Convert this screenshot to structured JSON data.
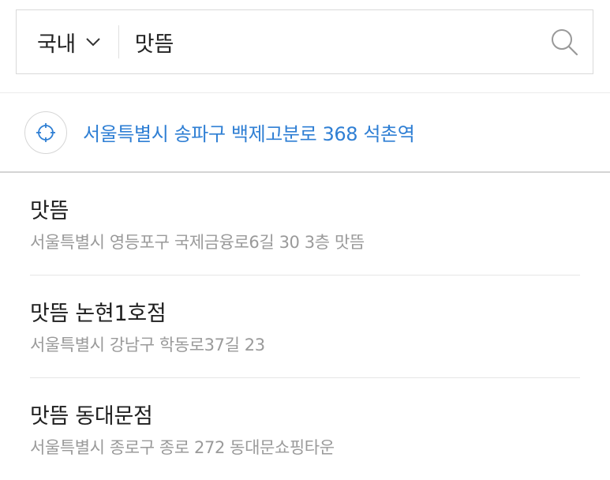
{
  "search": {
    "region": "국내",
    "query": "맛뜸"
  },
  "current_location": {
    "address": "서울특별시 송파구 백제고분로 368 석촌역"
  },
  "results": [
    {
      "title": "맛뜸",
      "address": "서울특별시 영등포구 국제금융로6길 30 3층 맛뜸"
    },
    {
      "title": "맛뜸 논현1호점",
      "address": "서울특별시 강남구 학동로37길 23"
    },
    {
      "title": "맛뜸 동대문점",
      "address": "서울특별시 종로구 종로 272 동대문쇼핑타운"
    }
  ],
  "colors": {
    "accent": "#2f7fd4",
    "secondary_text": "#9a9a9a",
    "border": "#d9d9d9"
  },
  "icons": {
    "region_dropdown": "chevron-down-icon",
    "search": "search-icon",
    "location": "crosshair-icon"
  }
}
